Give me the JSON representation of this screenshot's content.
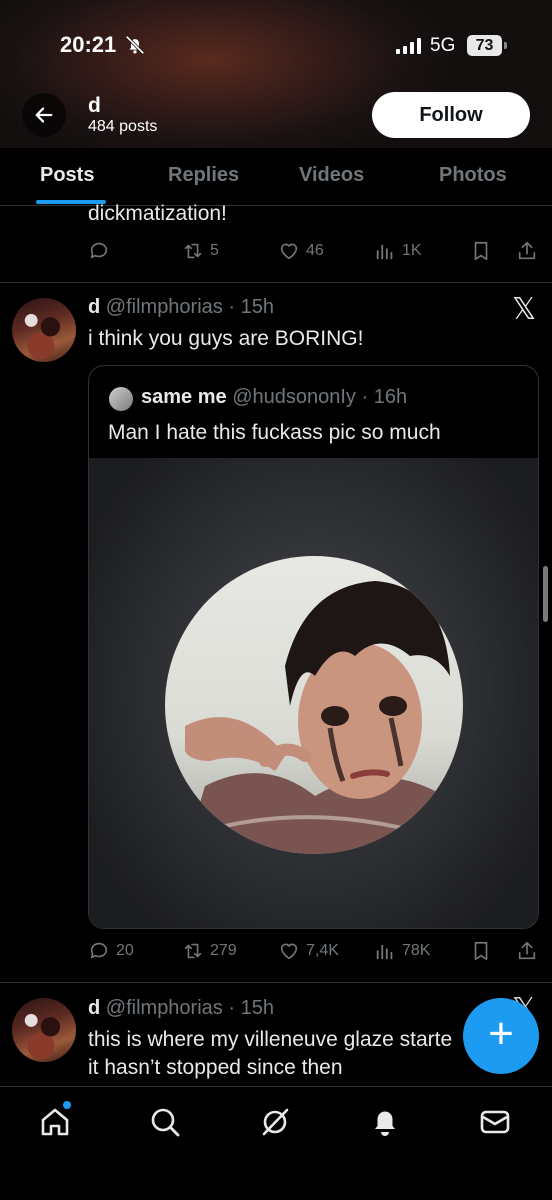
{
  "status_bar": {
    "time": "20:21",
    "network": "5G",
    "battery": "73"
  },
  "header": {
    "profile_name": "d",
    "post_count": "484 posts",
    "follow_label": "Follow"
  },
  "tabs": [
    {
      "label": "Posts",
      "active": true
    },
    {
      "label": "Replies",
      "active": false
    },
    {
      "label": "Videos",
      "active": false
    },
    {
      "label": "Photos",
      "active": false
    }
  ],
  "previous_tweet": {
    "text_fragment": "dickmatization!",
    "replies": "",
    "retweets": "5",
    "likes": "46",
    "views": "1K"
  },
  "tweet": {
    "name": "d",
    "handle": "@filmphorias",
    "time": "· 15h",
    "text": "i think you guys are BORING!",
    "quote": {
      "name": "same me",
      "handle": "@hudsononIy",
      "time": "· 16h",
      "text": "Man I hate this fuckass pic so much"
    },
    "replies": "20",
    "retweets": "279",
    "likes": "7,4K",
    "views": "78K"
  },
  "next_tweet": {
    "name": "d",
    "handle": "@filmphorias",
    "time": "· 15h",
    "line1": "this is where my villeneuve glaze starte",
    "line2": "it hasn’t stopped since then"
  },
  "fab_label": "+",
  "colors": {
    "accent": "#1d9bf0",
    "secondary_text": "#71767b",
    "divider": "#2f3336"
  },
  "icons": [
    "back-arrow-icon",
    "bell-slash-icon",
    "reply-icon",
    "retweet-icon",
    "like-icon",
    "views-icon",
    "bookmark-icon",
    "share-icon",
    "x-logo-icon",
    "home-icon",
    "search-icon",
    "grok-icon",
    "notifications-icon",
    "messages-icon"
  ]
}
